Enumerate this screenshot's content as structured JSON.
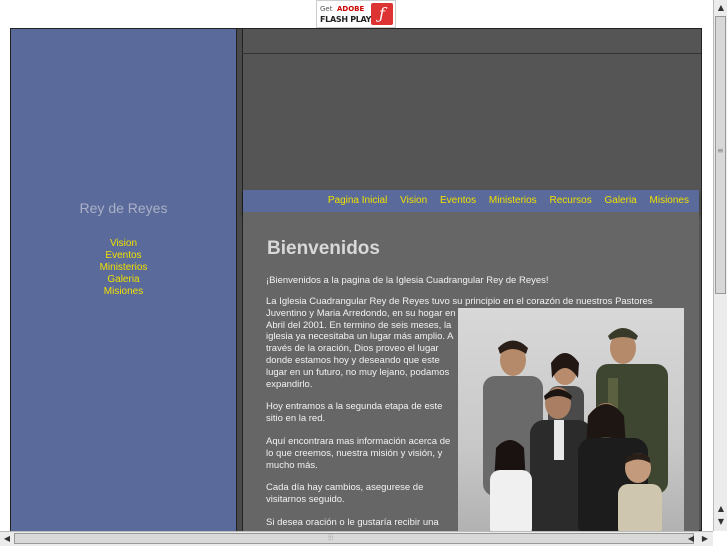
{
  "flash_badge": {
    "get": "Get",
    "adobe": "ADOBE",
    "player": "FLASH PLAYER"
  },
  "sidebar": {
    "title": "Rey de Reyes",
    "items": [
      "Vision",
      "Eventos",
      "Ministerios",
      "Galeria",
      "Misiones"
    ]
  },
  "nav": {
    "items": [
      "Pagina Inicial",
      "Vision",
      "Eventos",
      "Ministerios",
      "Recursos",
      "Galeria",
      "Misiones"
    ]
  },
  "main": {
    "heading": "Bienvenidos",
    "intro": "¡Bienvenidos a la pagina de la Iglesia Cuadrangular Rey de Reyes!",
    "para1_line": " La Iglesia Cuadrangular Rey de Reyes tuvo su principio en el corazón de nuestros Pastores",
    "para1_rest": "Juventino y Maria Arredondo, en su hogar en Abril del 2001. En termino de seis meses, la iglesia ya necesitaba un lugar más amplio. A través de la oración, Dios proveo el lugar donde estamos hoy y deseando que este lugar en un futuro, no muy lejano, podamos expandirlo.",
    "para2": "Hoy entramos a la segunda etapa de este sitio en la red.",
    "para3": "Aquí encontrara mas información acerca de lo que creemos, nuestra misión y visión, y mucho más.",
    "para4": "Cada día hay cambios, asegurese de visitarnos seguido.",
    "para5": "Si desea oración o le gustaría recibir una"
  },
  "colors": {
    "sidebar_bg": "#5a6a9a",
    "link": "#f0e000",
    "main_bg": "#666666"
  }
}
